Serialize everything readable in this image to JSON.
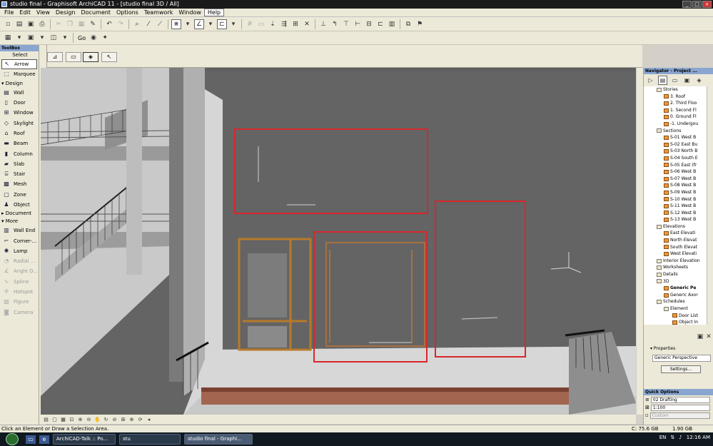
{
  "window": {
    "title": "studio final - Graphisoft ArchiCAD 11 - [studio final 3D / All]",
    "minimize": "_",
    "maximize": "□",
    "close": "×"
  },
  "menu": [
    "File",
    "Edit",
    "View",
    "Design",
    "Document",
    "Options",
    "Teamwork",
    "Window",
    "Help"
  ],
  "toolbar2": {
    "go_label": "Go"
  },
  "toolbox": {
    "title": "ToolBox",
    "select_header": "Select",
    "arrow": "Arrow",
    "marquee": "Marquee",
    "design_header": "Design",
    "design_tools": [
      "Wall",
      "Door",
      "Window",
      "Skylight",
      "Roof",
      "Beam",
      "Column",
      "Slab",
      "Stair",
      "Mesh",
      "Zone",
      "Object"
    ],
    "document_header": "Document",
    "more_header": "More",
    "more_tools": [
      "Wall End",
      "Corner-...",
      "Lamp",
      "Radial ...",
      "Angle D...",
      "Spline",
      "Hotspot",
      "Figure",
      "Camera"
    ]
  },
  "navigator": {
    "title": "Navigator - Project ...",
    "tree": [
      {
        "label": "Stories",
        "level": 1,
        "type": "folder"
      },
      {
        "label": "3. Roof",
        "level": 2,
        "type": "item"
      },
      {
        "label": "2. Third Floo",
        "level": 2,
        "type": "item"
      },
      {
        "label": "1. Second Fl",
        "level": 2,
        "type": "item"
      },
      {
        "label": "0. Ground Fl",
        "level": 2,
        "type": "item"
      },
      {
        "label": "-1. Undergou",
        "level": 2,
        "type": "item"
      },
      {
        "label": "Sections",
        "level": 1,
        "type": "folder"
      },
      {
        "label": "S-01 West B",
        "level": 2,
        "type": "item"
      },
      {
        "label": "S-02 East Bu",
        "level": 2,
        "type": "item"
      },
      {
        "label": "S-03 North B",
        "level": 2,
        "type": "item"
      },
      {
        "label": "S-04 South E",
        "level": 2,
        "type": "item"
      },
      {
        "label": "S-05 East (fr",
        "level": 2,
        "type": "item"
      },
      {
        "label": "S-06 West B",
        "level": 2,
        "type": "item"
      },
      {
        "label": "S-07 West B",
        "level": 2,
        "type": "item"
      },
      {
        "label": "S-08 West B",
        "level": 2,
        "type": "item"
      },
      {
        "label": "S-09 West B",
        "level": 2,
        "type": "item"
      },
      {
        "label": "S-10 West B",
        "level": 2,
        "type": "item"
      },
      {
        "label": "S-11 West B",
        "level": 2,
        "type": "item"
      },
      {
        "label": "S-12 West B",
        "level": 2,
        "type": "item"
      },
      {
        "label": "S-13 West B",
        "level": 2,
        "type": "item"
      },
      {
        "label": "Elevations",
        "level": 1,
        "type": "folder"
      },
      {
        "label": "East Elevati",
        "level": 2,
        "type": "item"
      },
      {
        "label": "North Elevat",
        "level": 2,
        "type": "item"
      },
      {
        "label": "South Elevat",
        "level": 2,
        "type": "item"
      },
      {
        "label": "West Elevati",
        "level": 2,
        "type": "item"
      },
      {
        "label": "Interior Elevation",
        "level": 1,
        "type": "folder"
      },
      {
        "label": "Worksheets",
        "level": 1,
        "type": "folder"
      },
      {
        "label": "Details",
        "level": 1,
        "type": "folder"
      },
      {
        "label": "3D",
        "level": 1,
        "type": "folder"
      },
      {
        "label": "Generic Pe",
        "level": 2,
        "type": "item",
        "selected": true
      },
      {
        "label": "Generic Axor",
        "level": 2,
        "type": "item"
      },
      {
        "label": "Schedules",
        "level": 1,
        "type": "folder"
      },
      {
        "label": "Element",
        "level": 2,
        "type": "folder"
      },
      {
        "label": "Door List",
        "level": 3,
        "type": "item"
      },
      {
        "label": "Object In",
        "level": 3,
        "type": "item"
      }
    ],
    "properties_label": "Properties",
    "properties_value": "Generic Perspective",
    "settings_button": "Settings..."
  },
  "quick_options": {
    "title": "Quick Options",
    "layer_combo": "02 Drafting",
    "scale": "1:100",
    "custom": "Custom"
  },
  "status": {
    "message": "Click an Element or Draw a Selection Area.",
    "disk_c": "C: 75.6 GB",
    "disk_d": "1.90 GB"
  },
  "taskbar": {
    "tasks": [
      "ArchiCAD-Talk :: Po...",
      "stu",
      "studio final - Graphi..."
    ],
    "lang": "EN",
    "time": "12:16 AM"
  },
  "colors": {
    "viewport_bg": "#646464",
    "highlight_rect": "#d9262b",
    "window_frame": "#b87a2a",
    "floor_tile": "#a2654f"
  }
}
